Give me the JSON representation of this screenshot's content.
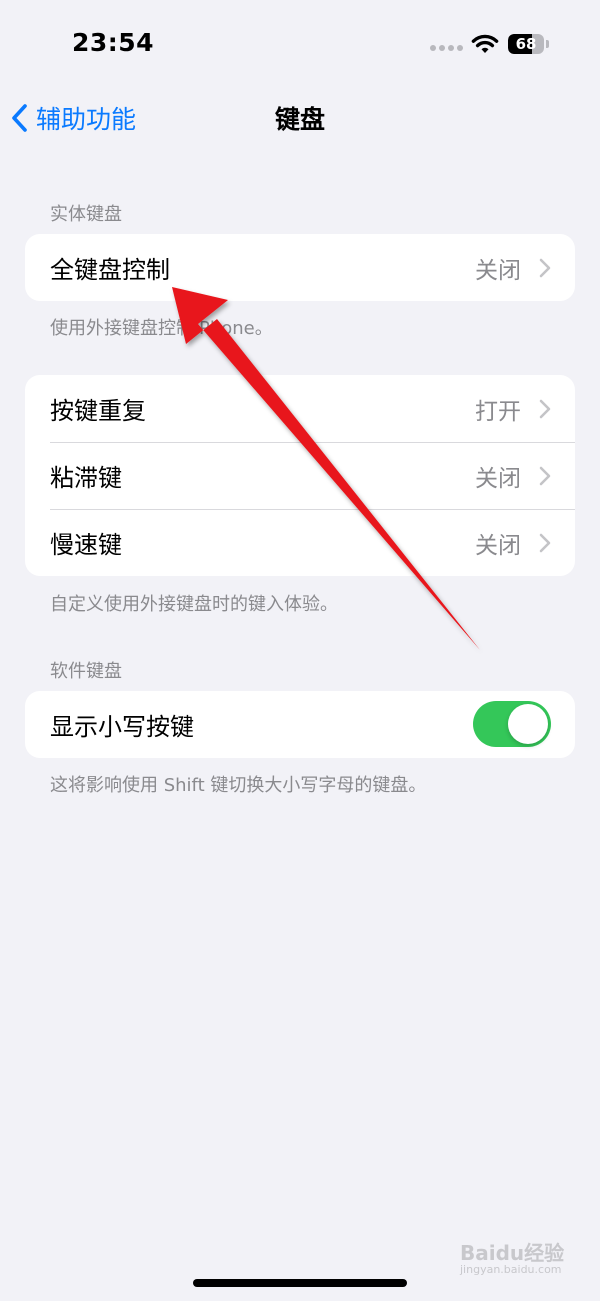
{
  "status_bar": {
    "time": "23:54",
    "battery_level": "68",
    "battery_fraction": 0.68,
    "icons": [
      "cellular-signal-icon",
      "wifi-icon",
      "battery-icon"
    ]
  },
  "nav": {
    "back_label": "辅助功能",
    "title": "键盘"
  },
  "sections": {
    "physical": {
      "header": "实体键盘",
      "full_keyboard_access": {
        "label": "全键盘控制",
        "value": "关闭"
      },
      "footer": "使用外接键盘控制iPhone。"
    },
    "keys": {
      "rows": [
        {
          "label": "按键重复",
          "value": "打开"
        },
        {
          "label": "粘滞键",
          "value": "关闭"
        },
        {
          "label": "慢速键",
          "value": "关闭"
        }
      ],
      "footer": "自定义使用外接键盘时的键入体验。"
    },
    "software": {
      "header": "软件键盘",
      "show_lowercase": {
        "label": "显示小写按键",
        "enabled": true
      },
      "footer": "这将影响使用 Shift 键切换大小写字母的键盘。"
    }
  },
  "colors": {
    "accent": "#0A7AFF",
    "toggle_on": "#34C759",
    "background": "#F2F2F7",
    "annotation": "#E8141A"
  },
  "watermark": {
    "main": "Baidu经验",
    "sub": "jingyan.baidu.com"
  }
}
